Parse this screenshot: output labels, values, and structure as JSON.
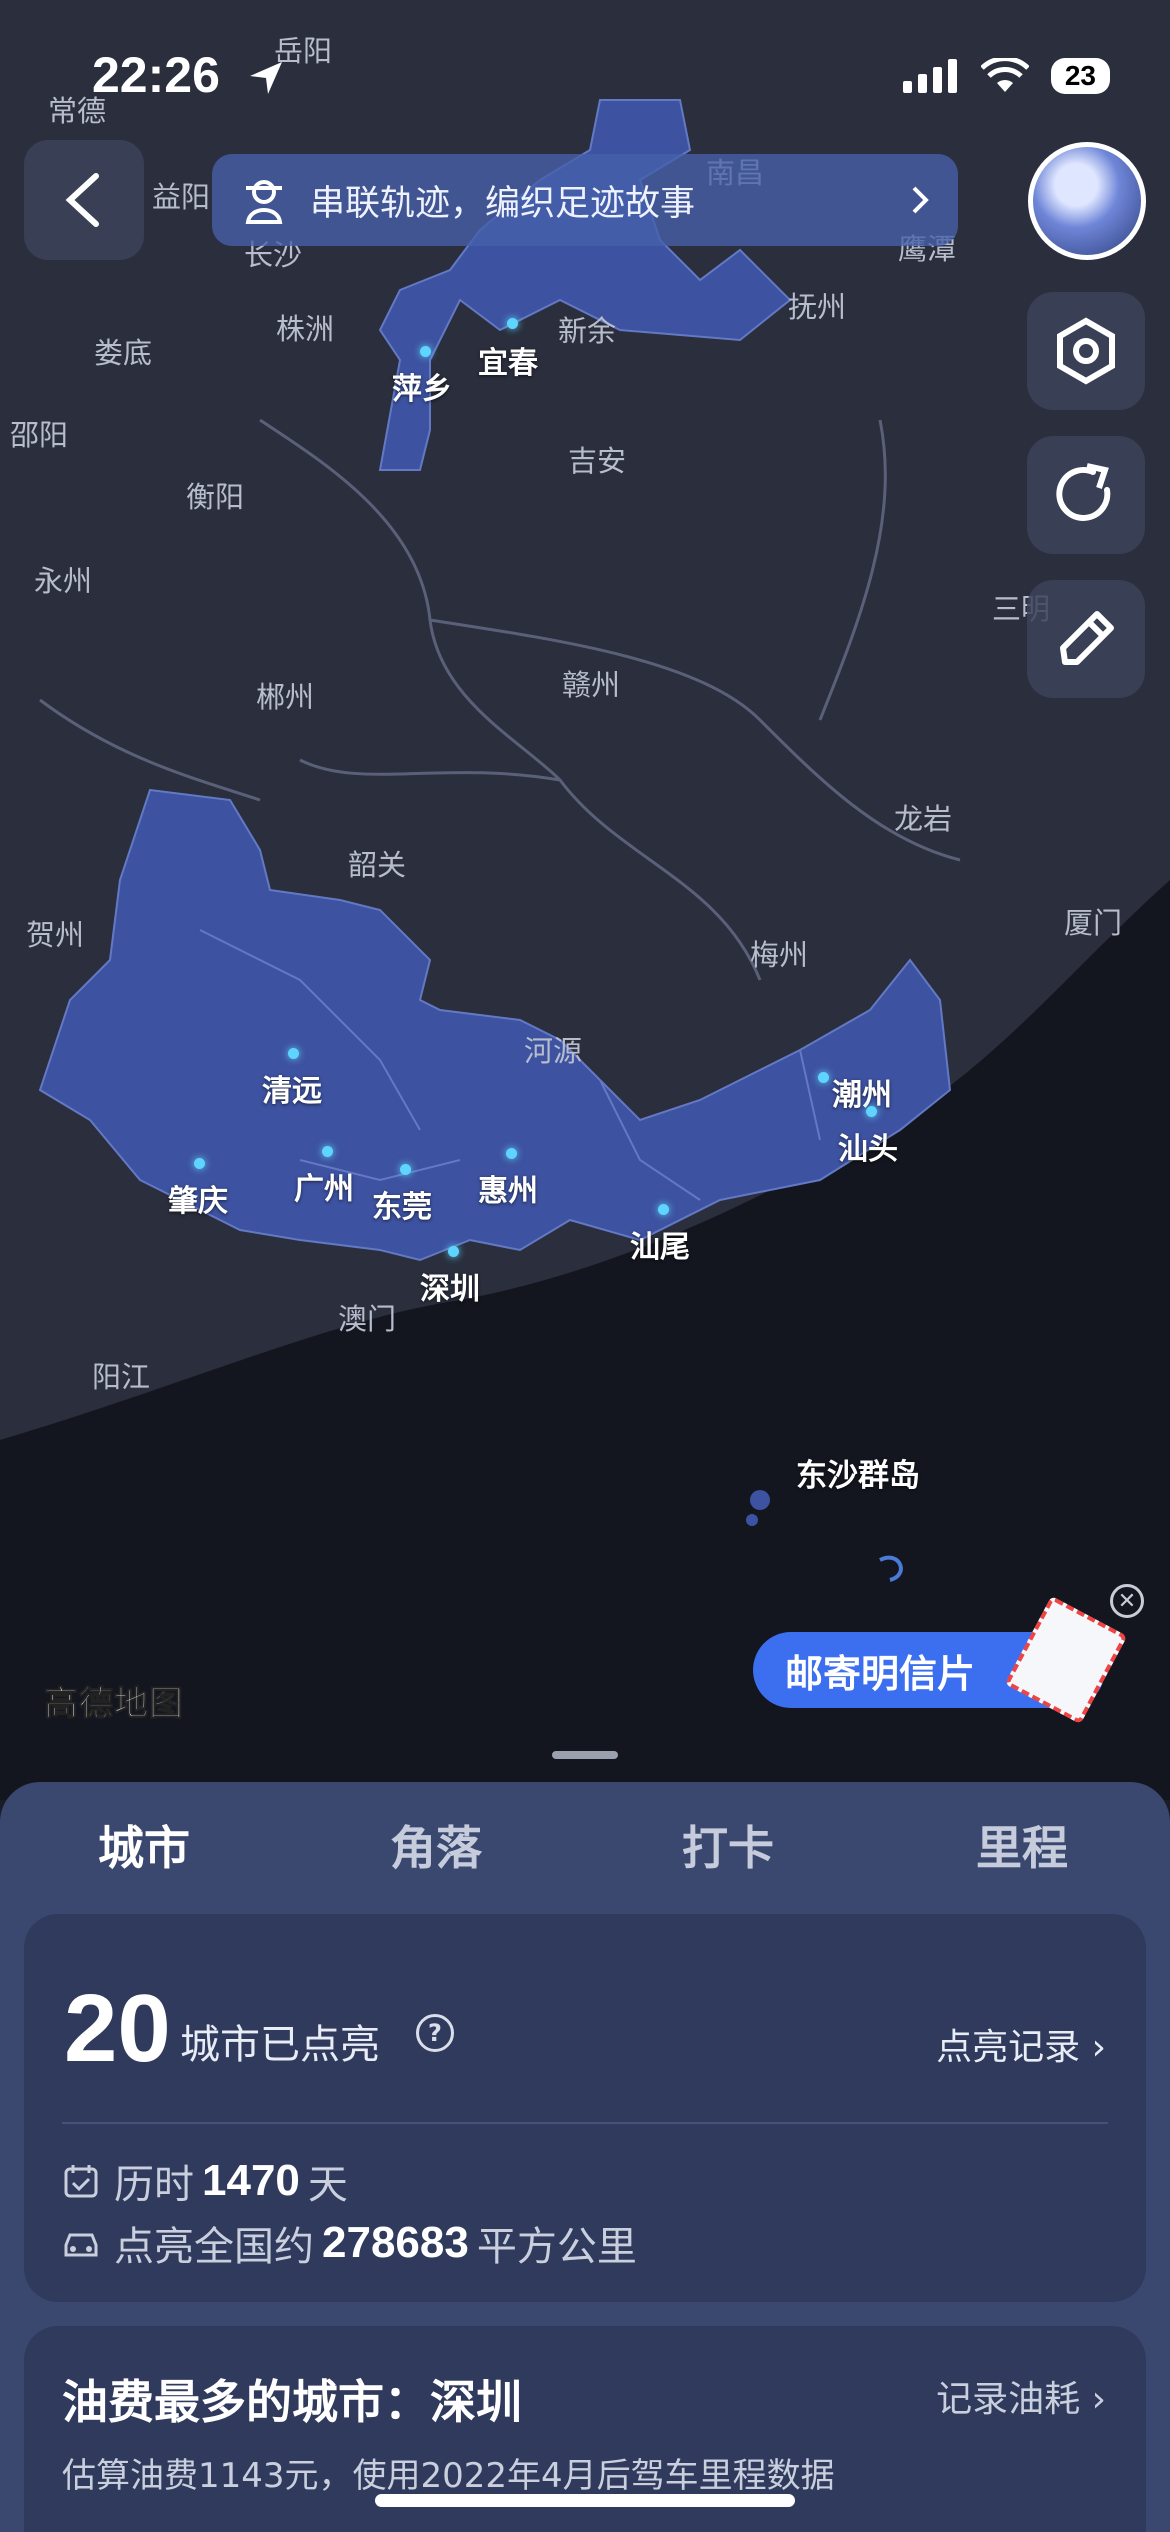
{
  "status_bar": {
    "time": "22:26",
    "battery": "23"
  },
  "banner": {
    "text": "串联轨迹，编织足迹故事"
  },
  "map": {
    "labels": [
      "常德",
      "岳阳",
      "益阳",
      "长沙",
      "南昌",
      "鹰潭",
      "抚州",
      "娄底",
      "株洲",
      "新余",
      "邵阳",
      "衡阳",
      "吉安",
      "永州",
      "郴州",
      "赣州",
      "三明",
      "龙岩",
      "韶关",
      "贺州",
      "梅州",
      "厦门",
      "河源",
      "阳江",
      "澳门"
    ],
    "lit_cities": [
      "宜春",
      "萍乡",
      "清远",
      "广州",
      "东莞",
      "惠州",
      "肇庆",
      "深圳",
      "汕尾",
      "潮州",
      "汕头"
    ],
    "islands_label": "东沙群岛",
    "brand": "高德地图",
    "postcard_button": "邮寄明信片"
  },
  "tabs": [
    {
      "label": "城市",
      "active": true
    },
    {
      "label": "角落",
      "active": false
    },
    {
      "label": "打卡",
      "active": false
    },
    {
      "label": "里程",
      "active": false
    }
  ],
  "stats": {
    "count": "20",
    "count_label": "城市已点亮",
    "record_link": "点亮记录",
    "duration_prefix": "历时",
    "duration_value": "1470",
    "duration_unit": "天",
    "area_prefix": "点亮全国约",
    "area_value": "278683",
    "area_unit": "平方公里"
  },
  "fuel": {
    "title": "油费最多的城市：深圳",
    "link": "记录油耗",
    "subtitle": "估算油费1143元，使用2022年4月后驾车里程数据"
  },
  "colors": {
    "lit_region": "#3d52a0",
    "dot": "#5fd4ff",
    "sheet": "#3a4870",
    "card": "#2f3a5c",
    "accent": "#3b6ff0"
  }
}
